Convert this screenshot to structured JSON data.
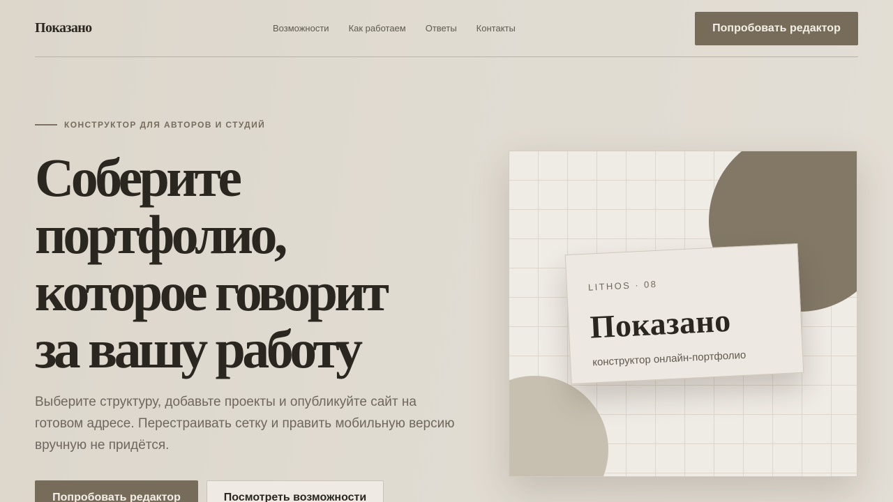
{
  "header": {
    "logo": "Показано",
    "nav": [
      "Возможности",
      "Как работаем",
      "Ответы",
      "Контакты"
    ],
    "cta_label": "Попробовать редактор"
  },
  "hero": {
    "eyebrow": "КОНСТРУКТОР ДЛЯ АВТОРОВ И СТУДИЙ",
    "headline_lines": [
      "Соберите",
      "портфолио,",
      "которое говорит",
      "за вашу работу"
    ],
    "lede": "Выберите структуру, добавьте проекты и опубликуйте сайт на готовом адресе. Перестраивать сетку и править мобильную версию вручную не придётся.",
    "primary_label": "Попробовать редактор",
    "secondary_label": "Посмотреть возможности"
  },
  "preview": {
    "kicker": "LITHOS · 08",
    "brand": "Показано",
    "subtitle": "конструктор онлайн-портфолио"
  },
  "colors": {
    "accent": "#776c5a",
    "background": "#e0dbd1",
    "text": "#2a2720",
    "circle_dark": "#837866",
    "circle_light": "#c7bfb0"
  }
}
